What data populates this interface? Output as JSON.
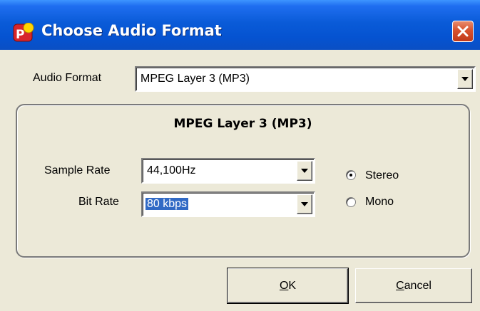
{
  "window": {
    "title": "Choose Audio Format"
  },
  "audio_format": {
    "label": "Audio Format",
    "value": "MPEG Layer 3 (MP3)"
  },
  "group": {
    "title": "MPEG Layer 3 (MP3)"
  },
  "sample_rate": {
    "label": "Sample Rate",
    "value": "44,100Hz"
  },
  "bit_rate": {
    "label": "Bit Rate",
    "value": "80 kbps"
  },
  "channels": {
    "stereo": {
      "label": "Stereo",
      "checked": true
    },
    "mono": {
      "label": "Mono",
      "checked": false
    }
  },
  "buttons": {
    "ok": {
      "label": "OK"
    },
    "cancel": {
      "label": "Cancel"
    }
  },
  "icons": {
    "app": "app-logo-icon",
    "close": "close-icon",
    "dropdown": "chevron-down-icon"
  },
  "colors": {
    "titlebar": "#0a5bd8",
    "selection": "#316ac5",
    "close": "#d7522f",
    "dialog": "#ece9d8"
  }
}
